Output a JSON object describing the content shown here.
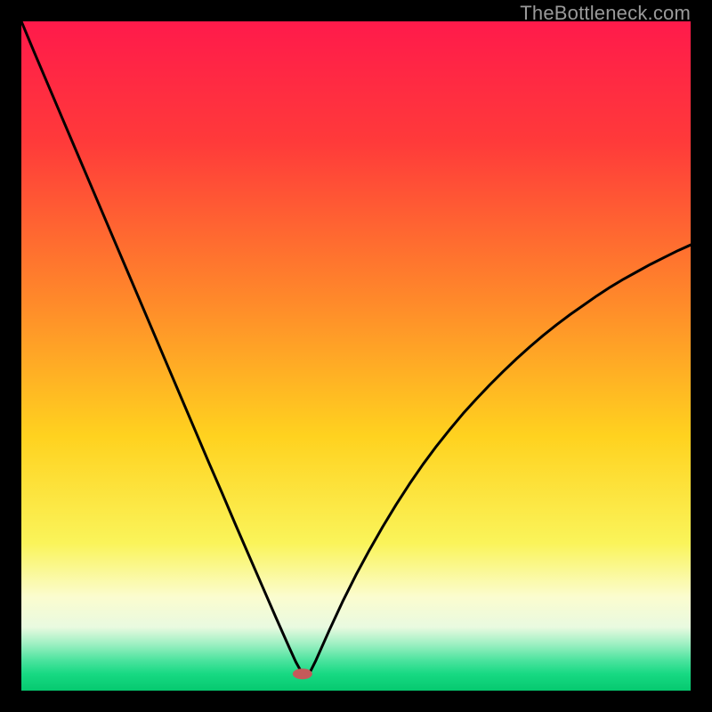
{
  "watermark": "TheBottleneck.com",
  "chart_data": {
    "type": "line",
    "title": "",
    "xlabel": "",
    "ylabel": "",
    "xlim": [
      0,
      100
    ],
    "ylim": [
      0,
      100
    ],
    "min_x": 42,
    "gradient_stops": [
      {
        "offset": 0,
        "color": "#ff1a4b"
      },
      {
        "offset": 0.18,
        "color": "#ff3a3a"
      },
      {
        "offset": 0.42,
        "color": "#ff8a2a"
      },
      {
        "offset": 0.62,
        "color": "#ffd21f"
      },
      {
        "offset": 0.78,
        "color": "#faf45a"
      },
      {
        "offset": 0.86,
        "color": "#fbfccf"
      },
      {
        "offset": 0.905,
        "color": "#e9fae0"
      },
      {
        "offset": 0.93,
        "color": "#9ff0c3"
      },
      {
        "offset": 0.955,
        "color": "#4be39e"
      },
      {
        "offset": 0.975,
        "color": "#17d983"
      },
      {
        "offset": 1.0,
        "color": "#06c96f"
      }
    ],
    "marker": {
      "x_pct": 42,
      "y_pct": 97.5,
      "color": "#c45a5a",
      "rx": 11,
      "ry": 6
    },
    "curve": {
      "x": [
        0,
        2,
        4,
        6,
        8,
        10,
        12,
        14,
        16,
        18,
        20,
        22,
        24,
        26,
        28,
        30,
        32,
        34,
        36,
        38,
        40,
        41,
        42,
        43,
        44,
        46,
        48,
        50,
        52,
        54,
        56,
        58,
        60,
        62,
        64,
        66,
        68,
        70,
        72,
        74,
        76,
        78,
        80,
        82,
        84,
        86,
        88,
        90,
        92,
        94,
        96,
        98,
        100
      ],
      "y": [
        100,
        95.2,
        90.5,
        85.8,
        81.1,
        76.4,
        71.7,
        67.0,
        62.3,
        57.6,
        52.9,
        48.2,
        43.5,
        38.8,
        34.1,
        29.5,
        24.8,
        20.2,
        15.6,
        11.0,
        6.5,
        4.3,
        2.5,
        2.5,
        4.5,
        9.0,
        13.3,
        17.3,
        21.0,
        24.5,
        27.8,
        30.9,
        33.8,
        36.5,
        39.0,
        41.4,
        43.6,
        45.7,
        47.7,
        49.6,
        51.4,
        53.1,
        54.7,
        56.2,
        57.6,
        59.0,
        60.3,
        61.5,
        62.6,
        63.7,
        64.7,
        65.7,
        66.6
      ]
    }
  }
}
